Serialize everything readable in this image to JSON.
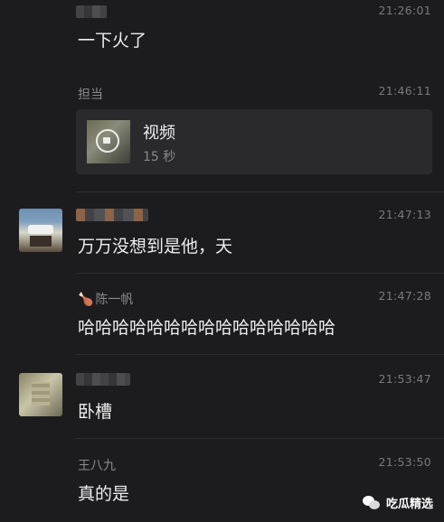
{
  "messages": [
    {
      "sender": "",
      "sender_blurred": true,
      "time": "21:26:01",
      "text": "一下火了"
    },
    {
      "sender": "担当",
      "time": "21:46:11",
      "video": {
        "title": "视频",
        "duration": "15 秒"
      }
    },
    {
      "sender": "",
      "sender_blurred": true,
      "time": "21:47:13",
      "text": "万万没想到是他，天"
    },
    {
      "sender": "陈一帆",
      "sender_prefix_icon": "drumstick-icon",
      "time": "21:47:28",
      "text": "哈哈哈哈哈哈哈哈哈哈哈哈哈哈哈"
    },
    {
      "sender": "",
      "sender_blurred": true,
      "time": "21:53:47",
      "text": "卧槽"
    },
    {
      "sender": "王八九",
      "time": "21:53:50",
      "text": "真的是"
    }
  ],
  "watermark": {
    "icon": "wechat-icon",
    "label": "吃瓜精选"
  }
}
